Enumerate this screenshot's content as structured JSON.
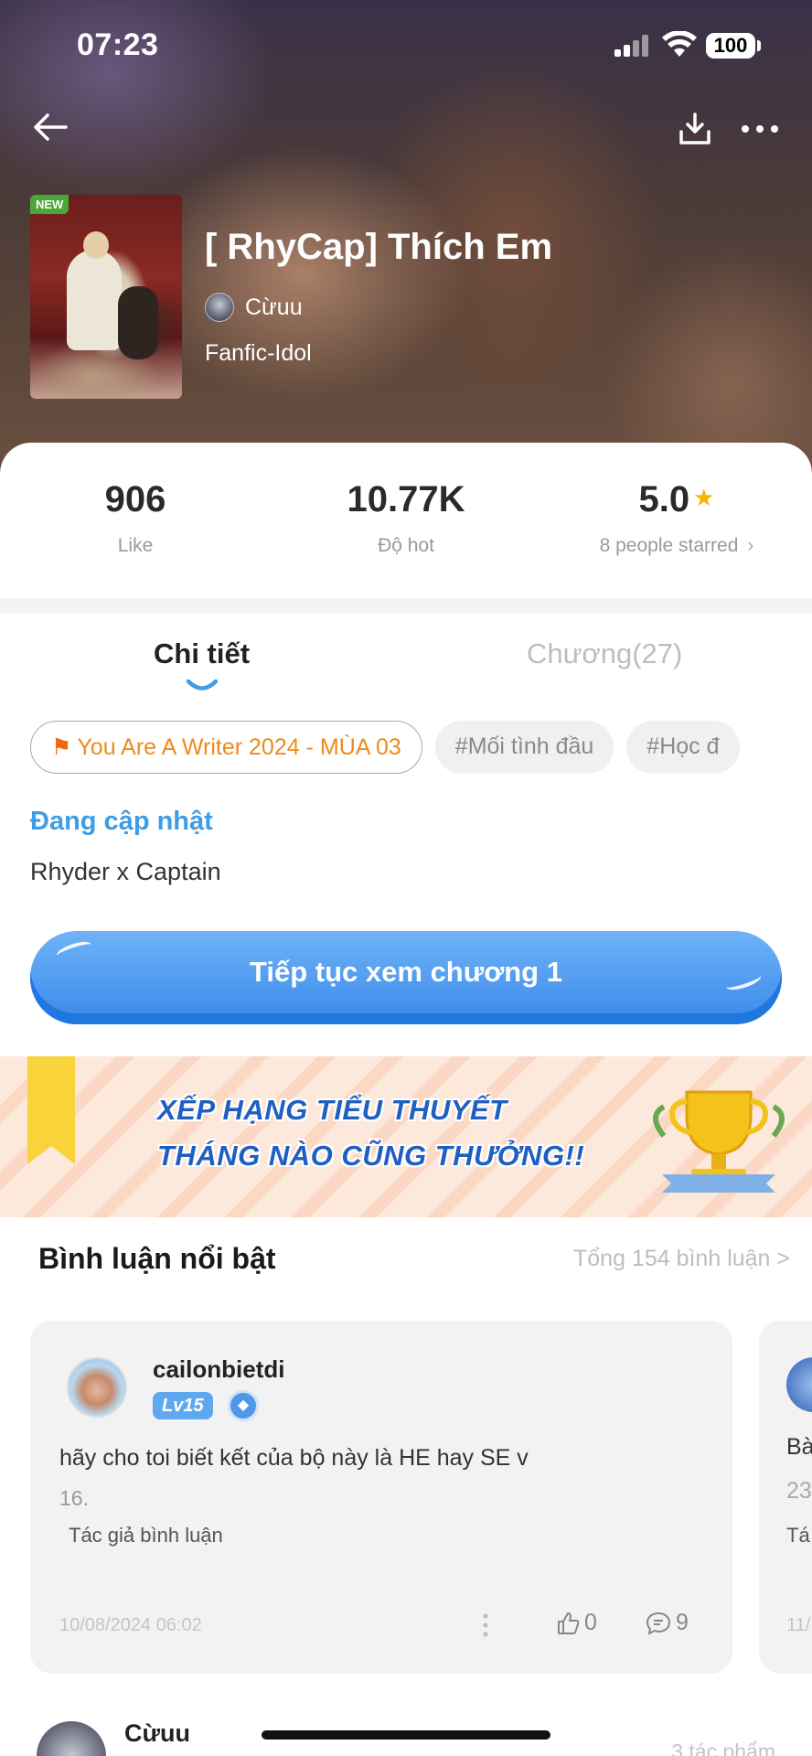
{
  "status_bar": {
    "time": "07:23",
    "battery": "100"
  },
  "book": {
    "badge": "NEW",
    "title": "[ RhyCap] Thích Em",
    "author": "Cừuu",
    "genre": "Fanfic-Idol"
  },
  "stats": {
    "likes": {
      "value": "906",
      "label": "Like"
    },
    "hot": {
      "value": "10.77K",
      "label": "Độ hot"
    },
    "rating": {
      "value": "5.0",
      "label": "8 people starred"
    }
  },
  "tabs": {
    "detail": "Chi tiết",
    "chapters": "Chương(27)"
  },
  "tags": [
    "You Are A Writer 2024 - MÙA 03",
    "#Mối tình đầu",
    "#Học đ"
  ],
  "update_status": "Đang cập nhật",
  "description": "Rhyder x Captain",
  "continue_button": "Tiếp tục xem chương 1",
  "banner": {
    "line1": "XẾP HẠNG TIỂU THUYẾT",
    "line2": "THÁNG NÀO CŨNG THƯỞNG!!"
  },
  "comments": {
    "title": "Bình luận nổi bật",
    "total": "Tổng 154 bình luận >",
    "featured": {
      "user": "cailonbietdi",
      "level": "Lv15",
      "text": "hãy cho toi biết kết của bộ này là HE hay SE v",
      "text_extra": "16.",
      "note": "Tác giả bình luận",
      "date": "10/08/2024 06:02",
      "likes": "0",
      "replies": "9"
    },
    "peek": {
      "line1": "Bà",
      "line2": "23",
      "line3": "Tá",
      "line4": "11/"
    },
    "next": {
      "user": "Cừuu",
      "right": "3 tác phẩm"
    }
  },
  "colors": {
    "accent": "#3d9de6",
    "button": "#4f9af0",
    "event_tag": "#ee8a1c",
    "star": "#f5b400"
  }
}
